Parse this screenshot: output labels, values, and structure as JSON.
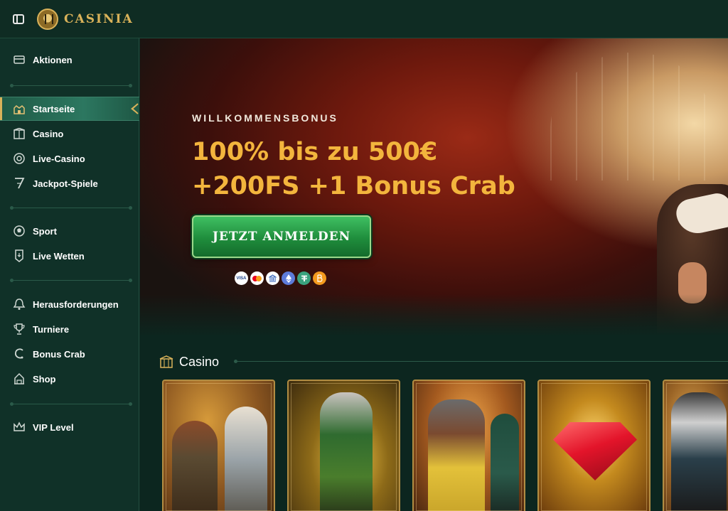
{
  "header": {
    "logo_text": "CASINIA",
    "menu_icon": "sidebar-toggle-icon"
  },
  "sidebar": {
    "groups": [
      [
        {
          "label": "Aktionen",
          "icon": "promotions-icon"
        }
      ],
      [
        {
          "label": "Startseite",
          "icon": "home-icon",
          "active": true
        },
        {
          "label": "Casino",
          "icon": "casino-icon"
        },
        {
          "label": "Live-Casino",
          "icon": "live-casino-icon"
        },
        {
          "label": "Jackpot-Spiele",
          "icon": "jackpot-icon"
        }
      ],
      [
        {
          "label": "Sport",
          "icon": "sport-icon"
        },
        {
          "label": "Live Wetten",
          "icon": "live-betting-icon"
        }
      ],
      [
        {
          "label": "Herausforderungen",
          "icon": "challenges-icon"
        },
        {
          "label": "Turniere",
          "icon": "trophy-icon"
        },
        {
          "label": "Bonus Crab",
          "icon": "bonus-crab-icon"
        },
        {
          "label": "Shop",
          "icon": "shop-icon"
        }
      ],
      [
        {
          "label": "VIP Level",
          "icon": "vip-crown-icon"
        }
      ]
    ]
  },
  "hero": {
    "kicker": "WILLKOMMENSBONUS",
    "headline_line1": "100% bis zu 500€",
    "headline_line2": "+200FS +1 Bonus Crab",
    "cta_label": "JETZT ANMELDEN",
    "payment_methods": [
      "VISA",
      "Mastercard",
      "Bank",
      "Ethereum",
      "Tether",
      "Bitcoin"
    ]
  },
  "casino_section": {
    "title": "Casino",
    "games": [
      {
        "icon": "game-explorer-icon"
      },
      {
        "icon": "game-magician-icon"
      },
      {
        "icon": "game-fisherman-icon"
      },
      {
        "icon": "game-gem-icon"
      },
      {
        "icon": "game-bandit-icon"
      }
    ]
  },
  "colors": {
    "accent_gold": "#f3b53d",
    "cta_green": "#1f8d3c",
    "sidebar_bg": "#103128",
    "active_item": "#2c7760"
  }
}
